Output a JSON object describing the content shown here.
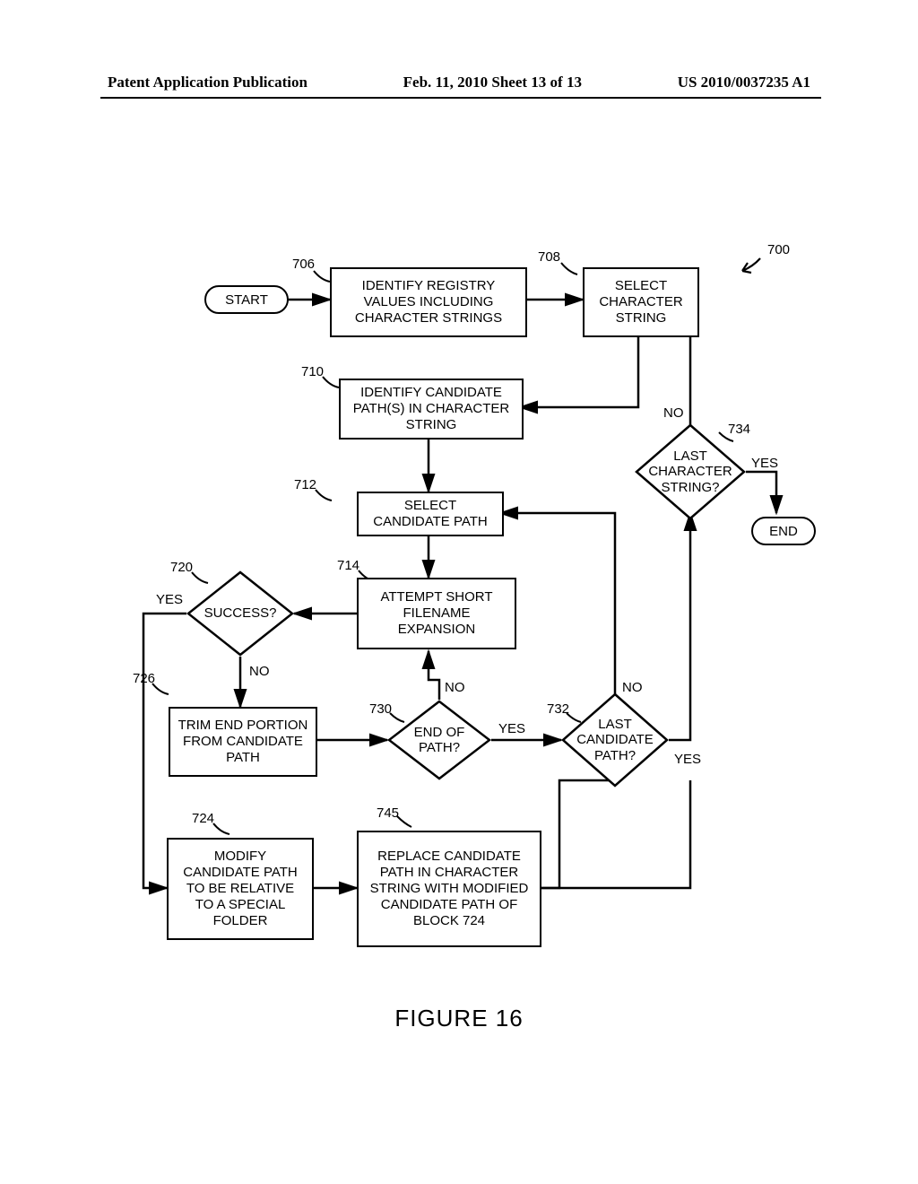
{
  "header": {
    "left": "Patent Application Publication",
    "center": "Feb. 11, 2010  Sheet 13 of 13",
    "right": "US 2010/0037235 A1"
  },
  "figure_caption": "FIGURE 16",
  "refs": {
    "r700": "700",
    "r706": "706",
    "r708": "708",
    "r710": "710",
    "r712": "712",
    "r714": "714",
    "r720": "720",
    "r724": "724",
    "r726": "726",
    "r730": "730",
    "r732": "732",
    "r734": "734",
    "r745": "745"
  },
  "nodes": {
    "start": "START",
    "end": "END",
    "b706": "IDENTIFY REGISTRY VALUES INCLUDING CHARACTER STRINGS",
    "b708": "SELECT CHARACTER STRING",
    "b710": "IDENTIFY CANDIDATE PATH(S) IN CHARACTER STRING",
    "b712": "SELECT CANDIDATE PATH",
    "b714": "ATTEMPT SHORT FILENAME EXPANSION",
    "d720": "SUCCESS?",
    "b724": "MODIFY CANDIDATE PATH TO BE RELATIVE TO A SPECIAL FOLDER",
    "b726": "TRIM END PORTION FROM CANDIDATE PATH",
    "d730": "END OF PATH?",
    "d732": "LAST CANDIDATE PATH?",
    "d734": "LAST CHARACTER STRING?",
    "b745": "REPLACE CANDIDATE PATH IN CHARACTER STRING WITH MODIFIED CANDIDATE PATH OF BLOCK 724"
  },
  "labels": {
    "yes": "YES",
    "no": "NO"
  }
}
